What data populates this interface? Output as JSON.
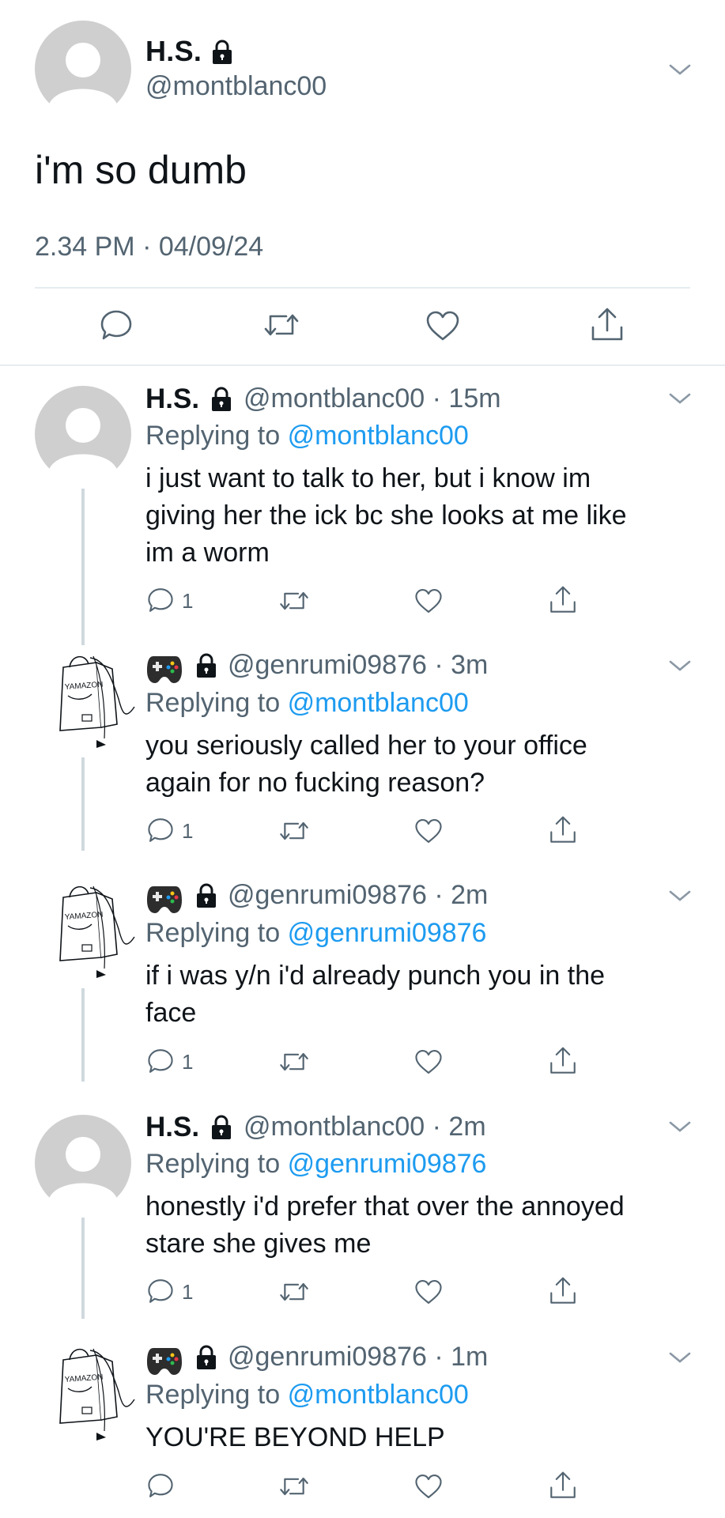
{
  "main_tweet": {
    "name": "H.S.",
    "handle": "@montblanc00",
    "text": "i'm so dumb",
    "timestamp": "2.34 PM · 04/09/24"
  },
  "replies": [
    {
      "name": "H.S.",
      "handle_time": "@montblanc00 · 15m",
      "replying_prefix": "Replying to",
      "replying_to": "@montblanc00",
      "lines": [
        "i just want to talk to her, but i know im",
        "giving her the ick bc she looks at me like",
        "im a worm"
      ],
      "reply_count": "1"
    },
    {
      "name": "",
      "handle_time": "@genrumi09876 · 3m",
      "replying_prefix": "Replying to",
      "replying_to": "@montblanc00",
      "lines": [
        "you seriously called her to your office",
        "again for no fucking reason?"
      ],
      "reply_count": "1"
    },
    {
      "name": "",
      "handle_time": "@genrumi09876 · 2m",
      "replying_prefix": "Replying to",
      "replying_to": "@genrumi09876",
      "lines": [
        "if i was y/n i'd already punch you in the",
        "face"
      ],
      "reply_count": "1"
    },
    {
      "name": "H.S.",
      "handle_time": "@montblanc00 · 2m",
      "replying_prefix": "Replying to",
      "replying_to": "@genrumi09876",
      "lines": [
        "honestly i'd prefer that over the annoyed",
        "stare she gives me"
      ],
      "reply_count": "1"
    },
    {
      "name": "",
      "handle_time": "@genrumi09876 · 1m",
      "replying_prefix": "Replying to",
      "replying_to": "@montblanc00",
      "lines": [
        "YOU'RE BEYOND HELP"
      ],
      "reply_count": ""
    }
  ],
  "avatar_logo_text": "YAMAZON",
  "icons": [
    "reply-icon",
    "retweet-icon",
    "like-icon",
    "share-icon",
    "lock-icon",
    "chevron-down-icon",
    "gamepad-icon"
  ],
  "colors": {
    "text": "#0f1419",
    "secondary": "#536471",
    "link": "#1d9bf0",
    "divider": "#e6ecf0"
  }
}
